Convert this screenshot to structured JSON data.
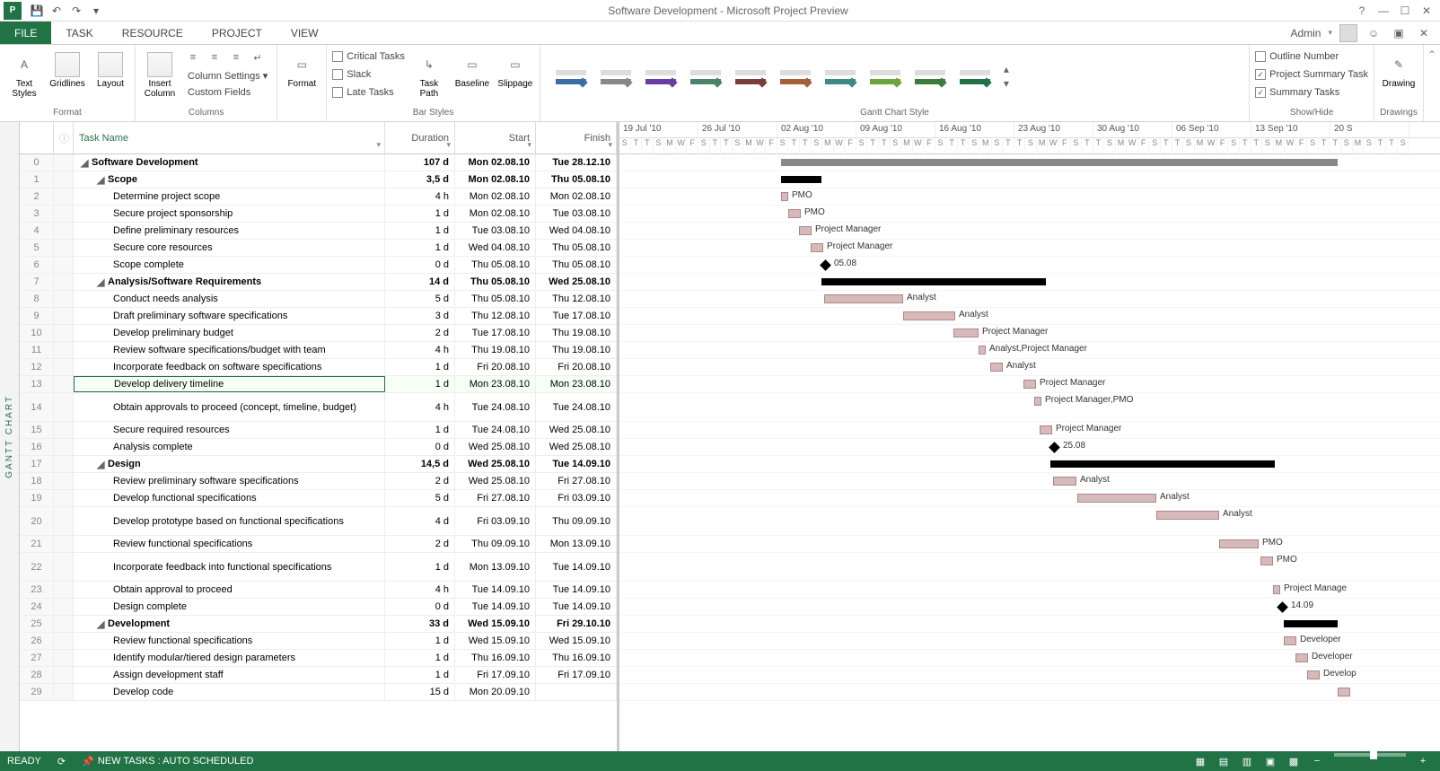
{
  "window": {
    "title": "Software Development - Microsoft Project Preview",
    "app_abbr": "P"
  },
  "tabs": {
    "file": "FILE",
    "task": "TASK",
    "resource": "RESOURCE",
    "project": "PROJECT",
    "view": "VIEW"
  },
  "user": "Admin",
  "ribbon": {
    "format": {
      "text_styles": "Text\nStyles",
      "gridlines": "Gridlines",
      "layout": "Layout",
      "label": "Format"
    },
    "columns": {
      "insert_column": "Insert\nColumn",
      "column_settings": "Column Settings",
      "custom_fields": "Custom Fields",
      "label": "Columns"
    },
    "format2": {
      "format": "Format",
      "label": ""
    },
    "barstyles": {
      "critical": "Critical Tasks",
      "slack": "Slack",
      "late": "Late Tasks",
      "task_path": "Task\nPath",
      "baseline": "Baseline",
      "slippage": "Slippage",
      "label": "Bar Styles"
    },
    "ganttstyle_label": "Gantt Chart Style",
    "showhide": {
      "outline_number": "Outline Number",
      "project_summary": "Project Summary Task",
      "summary_tasks": "Summary Tasks",
      "label": "Show/Hide"
    },
    "drawings": {
      "drawing": "Drawing",
      "label": "Drawings"
    }
  },
  "columns": {
    "task_name": "Task Name",
    "duration": "Duration",
    "start": "Start",
    "finish": "Finish"
  },
  "vtab": "GANTT CHART",
  "timeline_weeks": [
    "19 Jul '10",
    "26 Jul '10",
    "02 Aug '10",
    "09 Aug '10",
    "16 Aug '10",
    "23 Aug '10",
    "30 Aug '10",
    "06 Sep '10",
    "13 Sep '10",
    "20 S"
  ],
  "timeline_days": [
    "S",
    "T",
    "T",
    "S",
    "M",
    "W",
    "F",
    "S",
    "T",
    "T",
    "S",
    "M",
    "W",
    "F",
    "S",
    "T",
    "T",
    "S",
    "M",
    "W",
    "F",
    "S",
    "T",
    "T",
    "S",
    "M",
    "W",
    "F",
    "S",
    "T",
    "T",
    "S",
    "M"
  ],
  "tasks": [
    {
      "row": 0,
      "level": 0,
      "summary": true,
      "name": "Software Development",
      "dur": "107 d",
      "start": "Mon 02.08.10",
      "finish": "Tue 28.12.10",
      "gtype": "proj",
      "gleft": 180,
      "gwidth": 620
    },
    {
      "row": 1,
      "level": 1,
      "summary": true,
      "name": "Scope",
      "dur": "3,5 d",
      "start": "Mon 02.08.10",
      "finish": "Thu 05.08.10",
      "gtype": "sum",
      "gleft": 180,
      "gwidth": 45,
      "label": ""
    },
    {
      "row": 2,
      "level": 2,
      "name": "Determine project scope",
      "dur": "4 h",
      "start": "Mon 02.08.10",
      "finish": "Mon 02.08.10",
      "gtype": "task",
      "gleft": 180,
      "gwidth": 8,
      "label": "PMO"
    },
    {
      "row": 3,
      "level": 2,
      "name": "Secure project sponsorship",
      "dur": "1 d",
      "start": "Mon 02.08.10",
      "finish": "Tue 03.08.10",
      "gtype": "task",
      "gleft": 188,
      "gwidth": 14,
      "label": "PMO"
    },
    {
      "row": 4,
      "level": 2,
      "name": "Define preliminary resources",
      "dur": "1 d",
      "start": "Tue 03.08.10",
      "finish": "Wed 04.08.10",
      "gtype": "task",
      "gleft": 200,
      "gwidth": 14,
      "label": "Project Manager"
    },
    {
      "row": 5,
      "level": 2,
      "name": "Secure core resources",
      "dur": "1 d",
      "start": "Wed 04.08.10",
      "finish": "Thu 05.08.10",
      "gtype": "task",
      "gleft": 213,
      "gwidth": 14,
      "label": "Project Manager"
    },
    {
      "row": 6,
      "level": 2,
      "name": "Scope complete",
      "dur": "0 d",
      "start": "Thu 05.08.10",
      "finish": "Thu 05.08.10",
      "gtype": "ms",
      "gleft": 225,
      "label": "05.08"
    },
    {
      "row": 7,
      "level": 1,
      "summary": true,
      "name": "Analysis/Software Requirements",
      "dur": "14 d",
      "start": "Thu 05.08.10",
      "finish": "Wed 25.08.10",
      "gtype": "sum",
      "gleft": 225,
      "gwidth": 250
    },
    {
      "row": 8,
      "level": 2,
      "name": "Conduct needs analysis",
      "dur": "5 d",
      "start": "Thu 05.08.10",
      "finish": "Thu 12.08.10",
      "gtype": "task",
      "gleft": 228,
      "gwidth": 88,
      "label": "Analyst"
    },
    {
      "row": 9,
      "level": 2,
      "name": "Draft preliminary software specifications",
      "dur": "3 d",
      "start": "Thu 12.08.10",
      "finish": "Tue 17.08.10",
      "gtype": "task",
      "gleft": 316,
      "gwidth": 58,
      "label": "Analyst"
    },
    {
      "row": 10,
      "level": 2,
      "name": "Develop preliminary budget",
      "dur": "2 d",
      "start": "Tue 17.08.10",
      "finish": "Thu 19.08.10",
      "gtype": "task",
      "gleft": 372,
      "gwidth": 28,
      "label": "Project Manager"
    },
    {
      "row": 11,
      "level": 2,
      "name": "Review software specifications/budget with team",
      "dur": "4 h",
      "start": "Thu 19.08.10",
      "finish": "Thu 19.08.10",
      "gtype": "task",
      "gleft": 400,
      "gwidth": 8,
      "label": "Analyst,Project Manager"
    },
    {
      "row": 12,
      "level": 2,
      "name": "Incorporate feedback on software specifications",
      "dur": "1 d",
      "start": "Fri 20.08.10",
      "finish": "Fri 20.08.10",
      "gtype": "task",
      "gleft": 413,
      "gwidth": 14,
      "label": "Analyst"
    },
    {
      "row": 13,
      "level": 2,
      "name": "Develop delivery timeline",
      "dur": "1 d",
      "start": "Mon 23.08.10",
      "finish": "Mon 23.08.10",
      "gtype": "task",
      "gleft": 450,
      "gwidth": 14,
      "label": "Project Manager",
      "selected": true
    },
    {
      "row": 14,
      "level": 2,
      "name": "Obtain approvals to proceed (concept, timeline, budget)",
      "dur": "4 h",
      "start": "Tue 24.08.10",
      "finish": "Tue 24.08.10",
      "gtype": "task",
      "gleft": 462,
      "gwidth": 8,
      "label": "Project Manager,PMO",
      "tall": true
    },
    {
      "row": 15,
      "level": 2,
      "name": "Secure required resources",
      "dur": "1 d",
      "start": "Tue 24.08.10",
      "finish": "Wed 25.08.10",
      "gtype": "task",
      "gleft": 468,
      "gwidth": 14,
      "label": "Project Manager"
    },
    {
      "row": 16,
      "level": 2,
      "name": "Analysis complete",
      "dur": "0 d",
      "start": "Wed 25.08.10",
      "finish": "Wed 25.08.10",
      "gtype": "ms",
      "gleft": 480,
      "label": "25.08"
    },
    {
      "row": 17,
      "level": 1,
      "summary": true,
      "name": "Design",
      "dur": "14,5 d",
      "start": "Wed 25.08.10",
      "finish": "Tue 14.09.10",
      "gtype": "sum",
      "gleft": 480,
      "gwidth": 250
    },
    {
      "row": 18,
      "level": 2,
      "name": "Review preliminary software specifications",
      "dur": "2 d",
      "start": "Wed 25.08.10",
      "finish": "Fri 27.08.10",
      "gtype": "task",
      "gleft": 483,
      "gwidth": 26,
      "label": "Analyst"
    },
    {
      "row": 19,
      "level": 2,
      "name": "Develop functional specifications",
      "dur": "5 d",
      "start": "Fri 27.08.10",
      "finish": "Fri 03.09.10",
      "gtype": "task",
      "gleft": 510,
      "gwidth": 88,
      "label": "Analyst"
    },
    {
      "row": 20,
      "level": 2,
      "name": "Develop prototype based on functional specifications",
      "dur": "4 d",
      "start": "Fri 03.09.10",
      "finish": "Thu 09.09.10",
      "gtype": "task",
      "gleft": 598,
      "gwidth": 70,
      "label": "Analyst",
      "tall": true
    },
    {
      "row": 21,
      "level": 2,
      "name": "Review functional specifications",
      "dur": "2 d",
      "start": "Thu 09.09.10",
      "finish": "Mon 13.09.10",
      "gtype": "task",
      "gleft": 668,
      "gwidth": 44,
      "label": "PMO"
    },
    {
      "row": 22,
      "level": 2,
      "name": "Incorporate feedback into functional specifications",
      "dur": "1 d",
      "start": "Mon 13.09.10",
      "finish": "Tue 14.09.10",
      "gtype": "task",
      "gleft": 714,
      "gwidth": 14,
      "label": "PMO",
      "tall": true
    },
    {
      "row": 23,
      "level": 2,
      "name": "Obtain approval to proceed",
      "dur": "4 h",
      "start": "Tue 14.09.10",
      "finish": "Tue 14.09.10",
      "gtype": "task",
      "gleft": 728,
      "gwidth": 8,
      "label": "Project Manage"
    },
    {
      "row": 24,
      "level": 2,
      "name": "Design complete",
      "dur": "0 d",
      "start": "Tue 14.09.10",
      "finish": "Tue 14.09.10",
      "gtype": "ms",
      "gleft": 734,
      "label": "14.09"
    },
    {
      "row": 25,
      "level": 1,
      "summary": true,
      "name": "Development",
      "dur": "33 d",
      "start": "Wed 15.09.10",
      "finish": "Fri 29.10.10",
      "gtype": "sum",
      "gleft": 740,
      "gwidth": 60
    },
    {
      "row": 26,
      "level": 2,
      "name": "Review functional specifications",
      "dur": "1 d",
      "start": "Wed 15.09.10",
      "finish": "Wed 15.09.10",
      "gtype": "task",
      "gleft": 740,
      "gwidth": 14,
      "label": "Developer"
    },
    {
      "row": 27,
      "level": 2,
      "name": "Identify modular/tiered design parameters",
      "dur": "1 d",
      "start": "Thu 16.09.10",
      "finish": "Thu 16.09.10",
      "gtype": "task",
      "gleft": 753,
      "gwidth": 14,
      "label": "Developer"
    },
    {
      "row": 28,
      "level": 2,
      "name": "Assign development staff",
      "dur": "1 d",
      "start": "Fri 17.09.10",
      "finish": "Fri 17.09.10",
      "gtype": "task",
      "gleft": 766,
      "gwidth": 14,
      "label": "Develop"
    },
    {
      "row": 29,
      "level": 2,
      "name": "Develop code",
      "dur": "15 d",
      "start": "Mon 20.09.10",
      "finish": "",
      "gtype": "task",
      "gleft": 800,
      "gwidth": 14,
      "label": ""
    }
  ],
  "statusbar": {
    "ready": "READY",
    "new_tasks": "NEW TASKS : AUTO SCHEDULED"
  },
  "style_colors": [
    "#3a6ea5",
    "#888",
    "#6a3da5",
    "#4a826a",
    "#7a3d3d",
    "#a5603a",
    "#3a8a8a",
    "#6aa53d",
    "#3d7a3d",
    "#217346"
  ]
}
